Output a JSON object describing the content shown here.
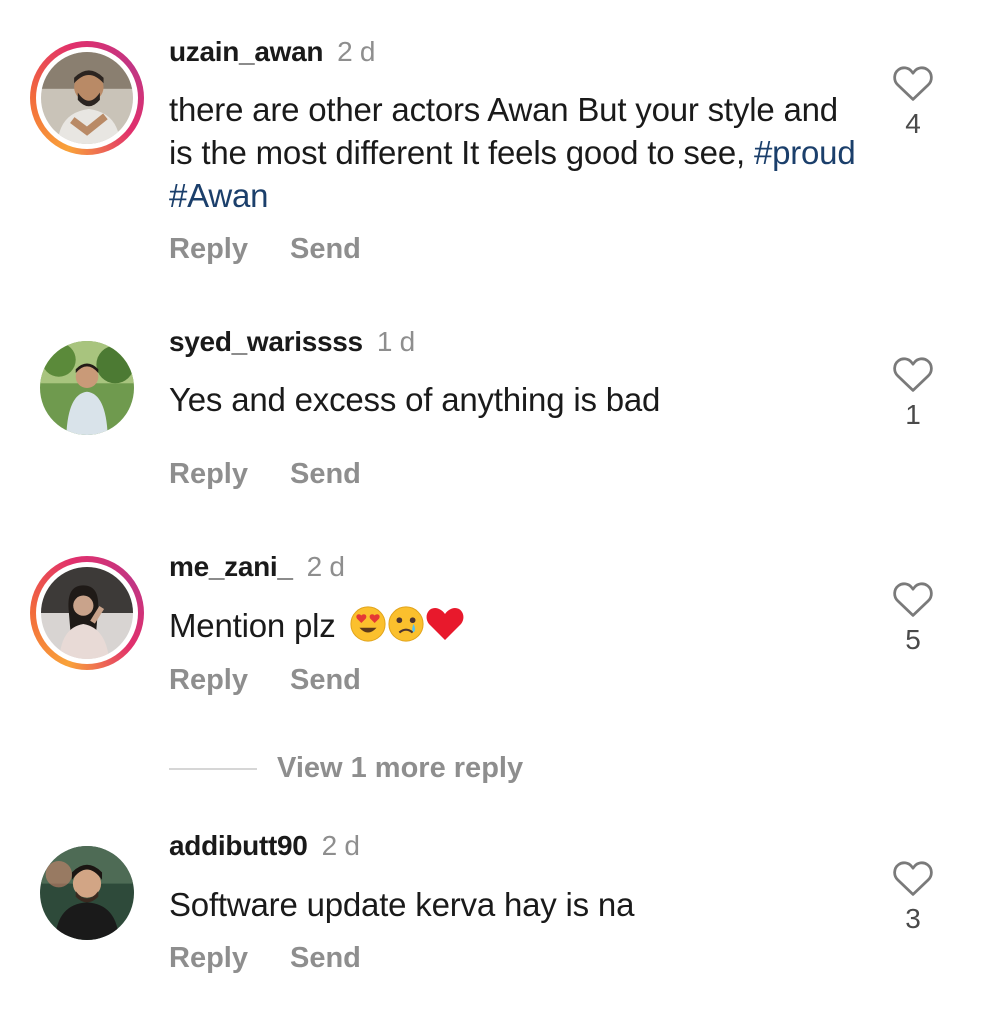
{
  "comments": [
    {
      "username": "uzain_awan",
      "time": "2 d",
      "text_plain": "there are other actors Awan But your style and is the most different It feels good to see, ",
      "hashtags": "#proud #Awan",
      "reply_label": "Reply",
      "send_label": "Send",
      "likes": "4",
      "has_story": true
    },
    {
      "username": "syed_warissss",
      "time": "1 d",
      "text_plain": "Yes and excess of anything is bad",
      "reply_label": "Reply",
      "send_label": "Send",
      "likes": "1",
      "has_story": false
    },
    {
      "username": "me_zani_",
      "time": "2 d",
      "text_plain": "Mention plz",
      "emojis": [
        "heart-eyes-emoji",
        "crying-emoji",
        "red-heart-emoji"
      ],
      "reply_label": "Reply",
      "send_label": "Send",
      "likes": "5",
      "has_story": true
    },
    {
      "username": "addibutt90",
      "time": "2 d",
      "text_plain": "Software update kerva hay is na",
      "reply_label": "Reply",
      "send_label": "Send",
      "likes": "3",
      "has_story": false
    }
  ],
  "view_more_replies": "View 1 more reply",
  "colors": {
    "hashtag": "#1b3f6b",
    "muted": "#8e8e8e",
    "story_ring_start": "#f9a23a",
    "story_ring_end": "#c13584"
  },
  "icons": {
    "like": "heart-outline-icon"
  }
}
